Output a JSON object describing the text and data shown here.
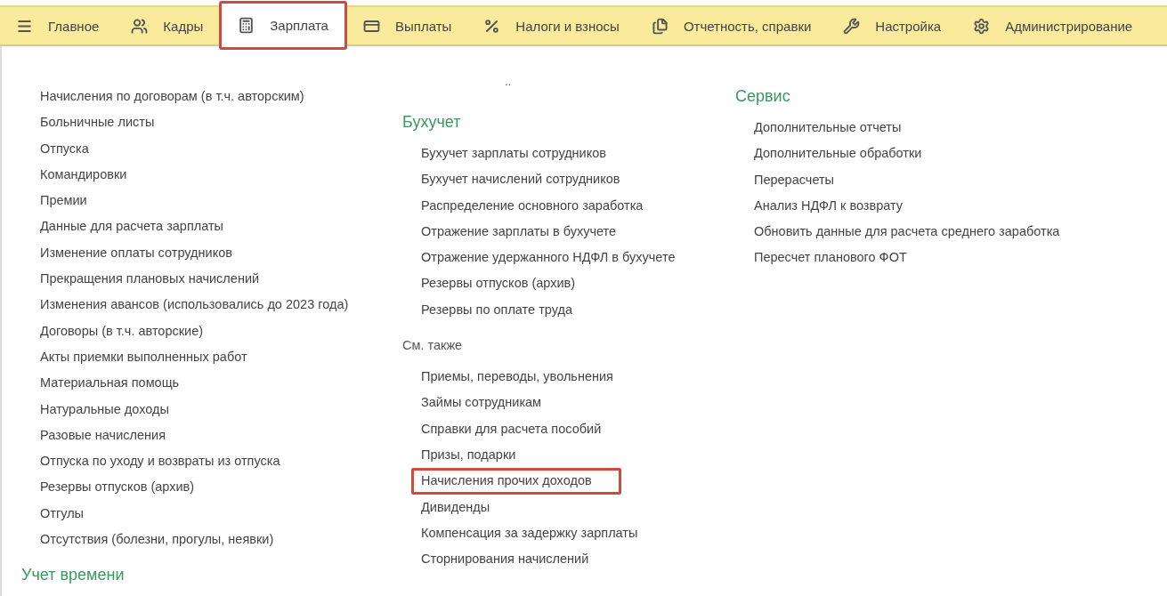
{
  "nav": {
    "items": [
      {
        "label": "Главное",
        "selected": false,
        "highlighted": false
      },
      {
        "label": "Кадры",
        "selected": false,
        "highlighted": false
      },
      {
        "label": "Зарплата",
        "selected": true,
        "highlighted": true
      },
      {
        "label": "Выплаты",
        "selected": false,
        "highlighted": false
      },
      {
        "label": "Налоги и взносы",
        "selected": false,
        "highlighted": false
      },
      {
        "label": "Отчетность, справки",
        "selected": false,
        "highlighted": false
      },
      {
        "label": "Настройка",
        "selected": false,
        "highlighted": false
      },
      {
        "label": "Администрирование",
        "selected": false,
        "highlighted": false
      }
    ]
  },
  "columns": [
    {
      "sections": [
        {
          "items": [
            {
              "label": "Начисления по договорам (в т.ч. авторским)",
              "highlighted": false
            },
            {
              "label": "Больничные листы",
              "highlighted": false
            },
            {
              "label": "Отпуска",
              "highlighted": false
            },
            {
              "label": "Командировки",
              "highlighted": false
            },
            {
              "label": "Премии",
              "highlighted": false
            },
            {
              "label": "Данные для расчета зарплаты",
              "highlighted": false
            },
            {
              "label": "Изменение оплаты сотрудников",
              "highlighted": false
            },
            {
              "label": "Прекращения плановых начислений",
              "highlighted": false
            },
            {
              "label": "Изменения авансов (использовались до 2023 года)",
              "highlighted": false
            },
            {
              "label": "Договоры (в т.ч. авторские)",
              "highlighted": false
            },
            {
              "label": "Акты приемки выполненных работ",
              "highlighted": false
            },
            {
              "label": "Материальная помощь",
              "highlighted": false
            },
            {
              "label": "Натуральные доходы",
              "highlighted": false
            },
            {
              "label": "Разовые начисления",
              "highlighted": false
            },
            {
              "label": "Отпуска по уходу и возвраты из отпуска",
              "highlighted": false
            },
            {
              "label": "Резервы отпусков (архив)",
              "highlighted": false
            },
            {
              "label": "Отгулы",
              "highlighted": false
            },
            {
              "label": "Отсутствия (болезни, прогулы, неявки)",
              "highlighted": false
            }
          ]
        },
        {
          "title": "Учет времени",
          "kind": "main"
        }
      ]
    },
    {
      "note": "..",
      "sections": [
        {
          "title": "Бухучет",
          "kind": "main",
          "items": [
            {
              "label": "Бухучет зарплаты сотрудников",
              "highlighted": false
            },
            {
              "label": "Бухучет начислений сотрудников",
              "highlighted": false
            },
            {
              "label": "Распределение основного заработка",
              "highlighted": false
            },
            {
              "label": "Отражение зарплаты в бухучете",
              "highlighted": false
            },
            {
              "label": "Отражение удержанного НДФЛ в бухучете",
              "highlighted": false
            },
            {
              "label": "Резервы отпусков (архив)",
              "highlighted": false
            },
            {
              "label": "Резервы по оплате труда",
              "highlighted": false
            }
          ]
        },
        {
          "title": "См. также",
          "kind": "minor",
          "items": [
            {
              "label": "Приемы, переводы, увольнения",
              "highlighted": false
            },
            {
              "label": "Займы сотрудникам",
              "highlighted": false
            },
            {
              "label": "Справки для расчета пособий",
              "highlighted": false
            },
            {
              "label": "Призы, подарки",
              "highlighted": false
            },
            {
              "label": "Начисления прочих доходов",
              "highlighted": true
            },
            {
              "label": "Дивиденды",
              "highlighted": false
            },
            {
              "label": "Компенсация за задержку зарплаты",
              "highlighted": false
            },
            {
              "label": "Сторнирования начислений",
              "highlighted": false
            }
          ]
        }
      ]
    },
    {
      "sections": [
        {
          "title": "Сервис",
          "kind": "main",
          "items": [
            {
              "label": "Дополнительные отчеты",
              "highlighted": false
            },
            {
              "label": "Дополнительные обработки",
              "highlighted": false
            },
            {
              "label": "Перерасчеты",
              "highlighted": false
            },
            {
              "label": "Анализ НДФЛ к возврату",
              "highlighted": false
            },
            {
              "label": "Обновить данные для расчета среднего заработка",
              "highlighted": false
            },
            {
              "label": "Пересчет планового ФОТ",
              "highlighted": false
            }
          ]
        }
      ]
    }
  ]
}
